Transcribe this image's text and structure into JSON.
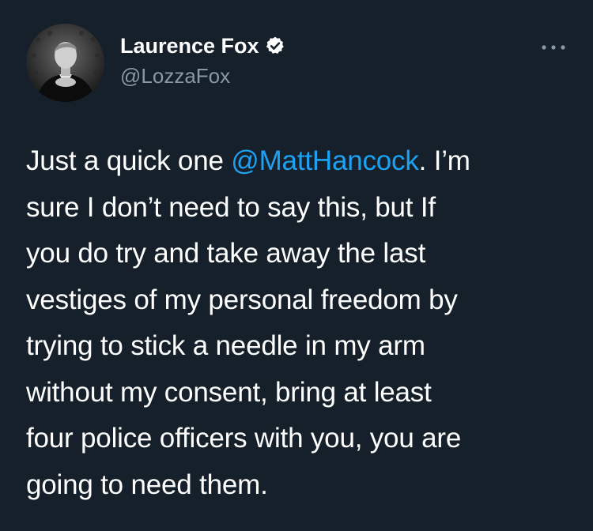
{
  "author": {
    "display_name": "Laurence Fox",
    "handle": "@LozzaFox",
    "verified": true,
    "avatar": "profile-photo"
  },
  "menu": {
    "icon": "more-dots-icon"
  },
  "tweet": {
    "lines": [
      {
        "pre": "Just a quick one ",
        "mention": "@MattHancock",
        "post": ". I’m"
      },
      {
        "text": "sure I don’t need to say this, but If"
      },
      {
        "text": "you do try and take away the last"
      },
      {
        "text": "vestiges of my personal freedom by"
      },
      {
        "text": "trying to stick a needle in my arm"
      },
      {
        "text": "without my consent, bring at least"
      },
      {
        "text": "four police officers with you, you are"
      },
      {
        "text": "going to need them."
      }
    ]
  },
  "colors": {
    "background": "#15202b",
    "text": "#ffffff",
    "secondary": "#8899a6",
    "link": "#1da1f2"
  }
}
